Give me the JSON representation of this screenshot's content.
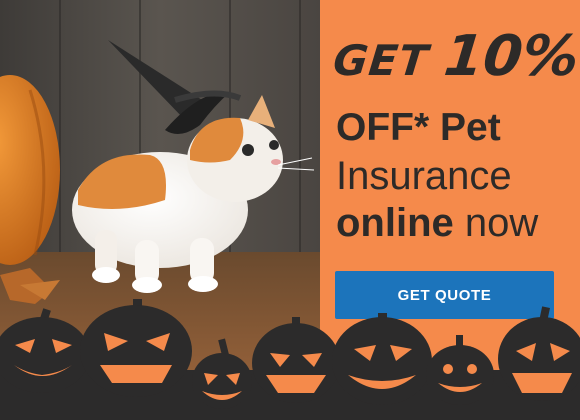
{
  "promo": {
    "line1_get": "GET",
    "line1_pct": "10%",
    "line2": "OFF* Pet",
    "line3": "Insurance",
    "line4_bold": "online",
    "line4_rest": " now"
  },
  "cta": {
    "label": "GET QUOTE"
  },
  "colors": {
    "panel": "#f58a4b",
    "headline": "#2d2a28",
    "button": "#1c74bb",
    "pumpkin_silhouette": "#2c2b2b",
    "pumpkin_glow": "#f58a4b"
  },
  "icons": {
    "photo": "kitten-in-witch-hat-photo",
    "decor": "jack-o-lantern-silhouettes"
  }
}
